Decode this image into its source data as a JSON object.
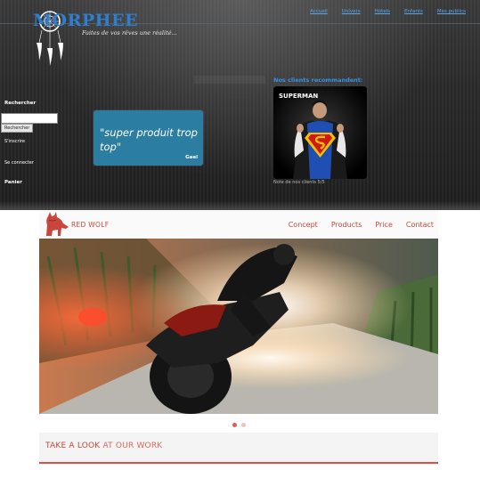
{
  "morphee": {
    "logo": "MORPHEE",
    "tagline": "Faites de vos rêves une réalité...",
    "nav": [
      "Accueil",
      "Univers",
      "Hôtels",
      "Enfants",
      "Mes publics"
    ],
    "sidebar": {
      "search_heading": "Rechercher",
      "search_value": "",
      "search_button": "Rechercher",
      "link_1": "S'inscrire",
      "link_2": "Se connecter",
      "cart": "Panier"
    },
    "quote": {
      "text": "\"super produit trop top\"",
      "author": "Gael"
    },
    "recommend": {
      "title": "Nos clients recommandent:",
      "image_title": "SUPERMAN",
      "caption": "Note de nos clients 5/5"
    }
  },
  "redwolf": {
    "brand": "RED WOLF",
    "nav": [
      "Concept",
      "Products",
      "Price",
      "Contact"
    ],
    "slider": {
      "active_slide": 1,
      "slide_count": 2
    },
    "section_title_part1": "TAKE A LOOK",
    "section_title_part2": "AT OUR WORK"
  },
  "colors": {
    "morphee_blue": "#2f7fd0",
    "quote_teal": "#2b7ea2",
    "wolf_red": "#c9463c"
  }
}
